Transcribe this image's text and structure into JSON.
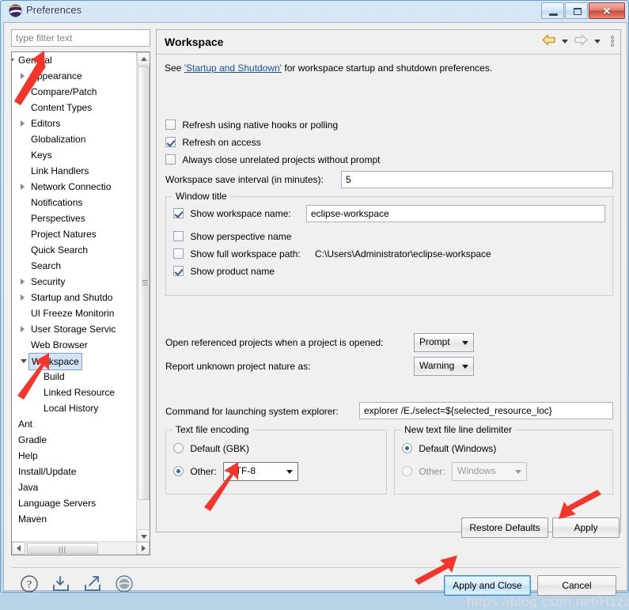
{
  "window": {
    "title": "Preferences",
    "icon": "eclipse-logo-icon",
    "buttons": {
      "minimize": "–",
      "maximize": "□",
      "close": "✕"
    }
  },
  "sidebar": {
    "filter": {
      "placeholder": "type filter text",
      "value": ""
    },
    "items": [
      {
        "label": "General",
        "indent": 0,
        "twisty": "expanded",
        "selected": false
      },
      {
        "label": "Appearance",
        "indent": 1,
        "twisty": "collapsed",
        "selected": false
      },
      {
        "label": "Compare/Patch",
        "indent": 1,
        "twisty": "none",
        "selected": false
      },
      {
        "label": "Content Types",
        "indent": 1,
        "twisty": "none",
        "selected": false
      },
      {
        "label": "Editors",
        "indent": 1,
        "twisty": "collapsed",
        "selected": false
      },
      {
        "label": "Globalization",
        "indent": 1,
        "twisty": "none",
        "selected": false
      },
      {
        "label": "Keys",
        "indent": 1,
        "twisty": "none",
        "selected": false
      },
      {
        "label": "Link Handlers",
        "indent": 1,
        "twisty": "none",
        "selected": false
      },
      {
        "label": "Network Connectio",
        "indent": 1,
        "twisty": "collapsed",
        "selected": false
      },
      {
        "label": "Notifications",
        "indent": 1,
        "twisty": "none",
        "selected": false
      },
      {
        "label": "Perspectives",
        "indent": 1,
        "twisty": "none",
        "selected": false
      },
      {
        "label": "Project Natures",
        "indent": 1,
        "twisty": "none",
        "selected": false
      },
      {
        "label": "Quick Search",
        "indent": 1,
        "twisty": "none",
        "selected": false
      },
      {
        "label": "Search",
        "indent": 1,
        "twisty": "none",
        "selected": false
      },
      {
        "label": "Security",
        "indent": 1,
        "twisty": "collapsed",
        "selected": false
      },
      {
        "label": "Startup and Shutdo",
        "indent": 1,
        "twisty": "collapsed",
        "selected": false
      },
      {
        "label": "UI Freeze Monitorin",
        "indent": 1,
        "twisty": "none",
        "selected": false
      },
      {
        "label": "User Storage Servic",
        "indent": 1,
        "twisty": "collapsed",
        "selected": false
      },
      {
        "label": "Web Browser",
        "indent": 1,
        "twisty": "none",
        "selected": false
      },
      {
        "label": "Workspace",
        "indent": 1,
        "twisty": "expanded",
        "selected": true
      },
      {
        "label": "Build",
        "indent": 2,
        "twisty": "none",
        "selected": false
      },
      {
        "label": "Linked Resource",
        "indent": 2,
        "twisty": "none",
        "selected": false
      },
      {
        "label": "Local History",
        "indent": 2,
        "twisty": "none",
        "selected": false
      },
      {
        "label": "Ant",
        "indent": 0,
        "twisty": "collapsed",
        "selected": false
      },
      {
        "label": "Gradle",
        "indent": 0,
        "twisty": "none",
        "selected": false
      },
      {
        "label": "Help",
        "indent": 0,
        "twisty": "collapsed",
        "selected": false
      },
      {
        "label": "Install/Update",
        "indent": 0,
        "twisty": "collapsed",
        "selected": false
      },
      {
        "label": "Java",
        "indent": 0,
        "twisty": "collapsed",
        "selected": false
      },
      {
        "label": "Language Servers",
        "indent": 0,
        "twisty": "collapsed",
        "selected": false
      },
      {
        "label": "Maven",
        "indent": 0,
        "twisty": "collapsed",
        "selected": false
      }
    ]
  },
  "page": {
    "title": "Workspace",
    "nav": {
      "back": "back-arrow-icon",
      "forward": "forward-arrow-icon",
      "menu": "view-menu-icon"
    },
    "intro": {
      "before": "See ",
      "link": "'Startup and Shutdown'",
      "after": " for workspace startup and shutdown preferences."
    },
    "checkboxes": [
      {
        "label": "Refresh using native hooks or polling",
        "checked": false
      },
      {
        "label": "Refresh on access",
        "checked": true
      },
      {
        "label": "Always close unrelated projects without prompt",
        "checked": false
      }
    ],
    "save_interval": {
      "label": "Workspace save interval (in minutes):",
      "value": "5"
    },
    "window_title_group": {
      "legend": "Window title",
      "show_workspace_name": {
        "label": "Show workspace name:",
        "checked": true,
        "value": "eclipse-workspace"
      },
      "show_perspective_name": {
        "label": "Show perspective name",
        "checked": false
      },
      "show_full_path": {
        "label": "Show full workspace path:",
        "checked": false,
        "value": "C:\\Users\\Administrator\\eclipse-workspace"
      },
      "show_product_name": {
        "label": "Show product name",
        "checked": true
      }
    },
    "open_referenced": {
      "label": "Open referenced projects when a project is opened:",
      "value": "Prompt"
    },
    "report_nature": {
      "label": "Report unknown project nature as:",
      "value": "Warning"
    },
    "explorer_command": {
      "label": "Command for launching system explorer:",
      "value": "explorer /E,/select=${selected_resource_loc}"
    },
    "encoding_group": {
      "legend": "Text file encoding",
      "default_label": "Default (GBK)",
      "default_checked": false,
      "other_label": "Other:",
      "other_checked": true,
      "other_value": "UTF-8"
    },
    "delimiter_group": {
      "legend": "New text file line delimiter",
      "default_label": "Default (Windows)",
      "default_checked": true,
      "other_label": "Other:",
      "other_checked": false,
      "other_value": "Windows"
    },
    "restore_defaults": "Restore Defaults",
    "apply": "Apply"
  },
  "footer": {
    "icons": [
      "help-icon",
      "import-icon",
      "export-icon",
      "about-icon"
    ],
    "apply_and_close": "Apply and Close",
    "cancel": "Cancel"
  },
  "watermark": "https://blog.csdn.net/Hzzz_",
  "colors": {
    "accent": "#3c8ccc",
    "link": "#1a4f9c",
    "annotation_arrow": "#f5352b",
    "selection": "#d3e5f5",
    "close_button": "#c94a38"
  }
}
